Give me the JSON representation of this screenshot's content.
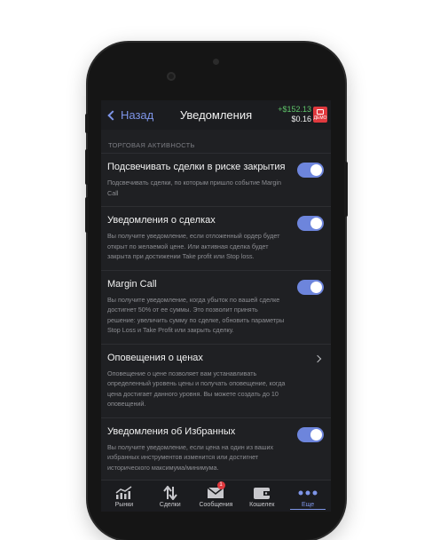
{
  "header": {
    "back_label": "Назад",
    "title": "Уведомления",
    "balance_change": "+$152.13",
    "balance_value": "$0.16",
    "demo_label": "ДЕМО"
  },
  "section": {
    "title": "ТОРГОВАЯ АКТИВНОСТЬ"
  },
  "settings": [
    {
      "title": "Подсвечивать сделки в риске закрытия",
      "desc": "Подсвечивать сделки, по которым пришло событие Margin Call",
      "control": "toggle",
      "on": true
    },
    {
      "title": "Уведомления о сделках",
      "desc": "Вы получите уведомление, если отложенный ордер будет открыт по желаемой цене. Или активная сделка будет закрыта при достижении Take profit или Stop loss.",
      "control": "toggle",
      "on": true
    },
    {
      "title": "Margin Call",
      "desc": "Вы получите уведомление, когда убыток по вашей сделке достигнет 50% от ее суммы. Это позволит принять решение: увеличить сумму по сделке, обновить параметры Stop Loss и Take Profit или закрыть сделку.",
      "control": "toggle",
      "on": true
    },
    {
      "title": "Оповещения о ценах",
      "desc": "Оповещение о цене позволяет вам устанавливать определенный уровень цены и получать оповещение, когда цена достигает данного уровня. Вы можете создать до 10 оповещений.",
      "control": "chevron"
    },
    {
      "title": "Уведомления об Избранных",
      "desc": "Вы получите уведомление, если цена на один из ваших избранных инструментов изменится или достигнет исторического максимума/минимума.",
      "control": "toggle",
      "on": true
    }
  ],
  "tabbar": {
    "items": [
      {
        "label": "Рынки",
        "icon": "chart-icon"
      },
      {
        "label": "Сделки",
        "icon": "trades-arrows-icon"
      },
      {
        "label": "Сообщения",
        "icon": "envelope-icon",
        "badge": "1"
      },
      {
        "label": "Кошелек",
        "icon": "wallet-icon"
      },
      {
        "label": "Еще",
        "icon": "more-dots-icon",
        "active": true
      }
    ]
  },
  "colors": {
    "accent": "#7e95e8",
    "toggle_on": "#6d85dc",
    "positive": "#5fc46a",
    "demo_badge": "#e0393e",
    "screen_bg": "#1f2023"
  }
}
